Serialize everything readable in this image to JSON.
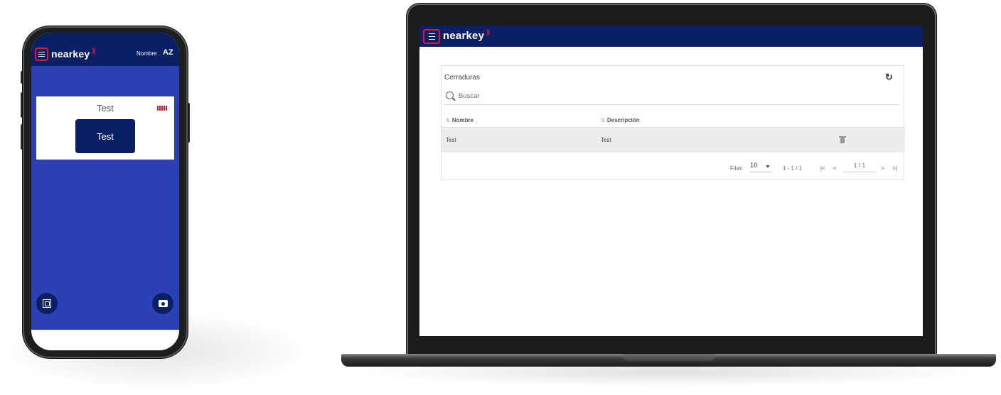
{
  "brand": {
    "name": "nearkey",
    "accent_color": "#e0192a",
    "header_color": "#0b1f66",
    "mobile_bg_color": "#2a40b4"
  },
  "mobile": {
    "sort_label": "Nombre",
    "sort_icon_text": "AZ",
    "lock_card": {
      "name": "Test",
      "button_label": "Test"
    },
    "fab_left_icon": "qr-code-icon",
    "fab_right_icon": "camera-icon"
  },
  "desktop": {
    "card_title": "Cerraduras",
    "refresh_icon": "↻",
    "search": {
      "placeholder": "Buscar",
      "value": ""
    },
    "sort_indicator": "⇅",
    "columns": [
      "Nombre",
      "Descripción"
    ],
    "rows": [
      {
        "nombre": "Test",
        "descripcion": "Test"
      }
    ],
    "pagination": {
      "rows_label": "Filas",
      "rows_per_page": "10",
      "range": "1 - 1 / 1",
      "first": "|<",
      "prev": "<",
      "page": "1 / 1",
      "next": ">",
      "last": ">|"
    }
  }
}
